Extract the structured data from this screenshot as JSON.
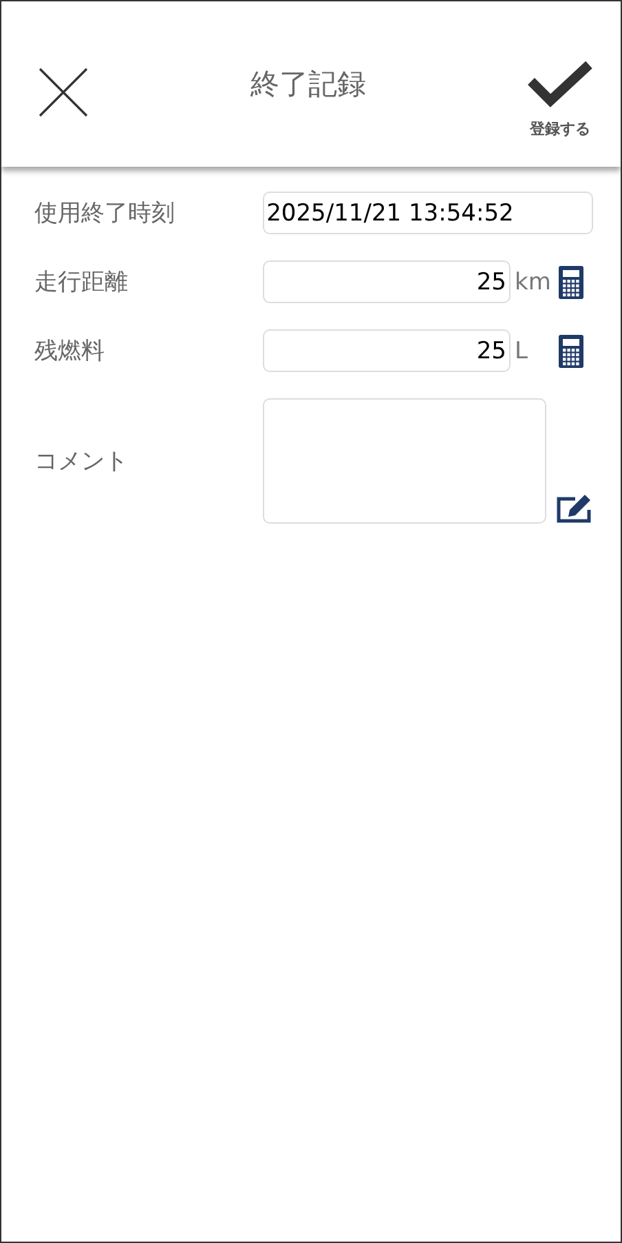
{
  "header": {
    "title": "終了記録",
    "confirm_label": "登録する"
  },
  "fields": [
    {
      "kind": "text",
      "label": "使用終了時刻",
      "value": "2025/11/21 13:54:52"
    },
    {
      "kind": "number",
      "label": "走行距離",
      "value": "25",
      "unit": "km"
    },
    {
      "kind": "number",
      "label": "残燃料",
      "value": "25",
      "unit": "L"
    },
    {
      "kind": "comment",
      "label": "コメント"
    }
  ]
}
